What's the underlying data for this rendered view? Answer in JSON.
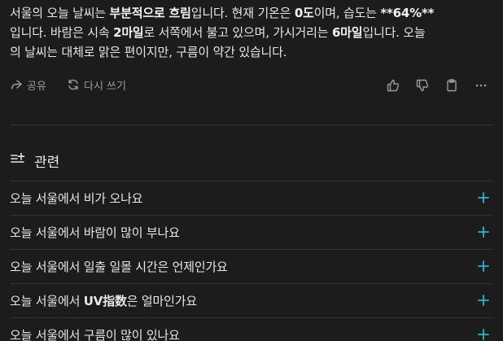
{
  "answer": {
    "line1_a": "서울의 오늘 날씨는 ",
    "line1_b": "부분적으로 흐림",
    "line1_c": "입니다. 현재 기온은 ",
    "line1_d": "0도",
    "line1_e": "이며, 습도는 ",
    "line1_f": "**64%**",
    "line2_a": "입니다. 바람은 시속 ",
    "line2_b": "2마일",
    "line2_c": "로 서쪽에서 불고 있으며, 가시거리는 ",
    "line2_d": "6마일",
    "line2_e": "입니다. 오늘",
    "line3": "의 날씨는 대체로 맑은 편이지만, 구름이 약간 있습니다."
  },
  "toolbar": {
    "share_label": "공유",
    "rewrite_label": "다시 쓰기"
  },
  "related": {
    "title": "관련",
    "items": [
      {
        "label": "오늘 서울에서 비가 오나요"
      },
      {
        "label": "오늘 서울에서 바람이 많이 부나요"
      },
      {
        "label": "오늘 서울에서 일출 일몰 시간은 언제인가요"
      },
      {
        "label_a": "오늘 서울에서 ",
        "label_b": "UV指数",
        "label_c": "은 얼마인가요"
      },
      {
        "label": "오늘 서울에서 구름이 많이 있나요"
      }
    ]
  },
  "colors": {
    "background": "#1c1c1d",
    "accent": "#20b8cd",
    "muted": "#9a9a98"
  }
}
